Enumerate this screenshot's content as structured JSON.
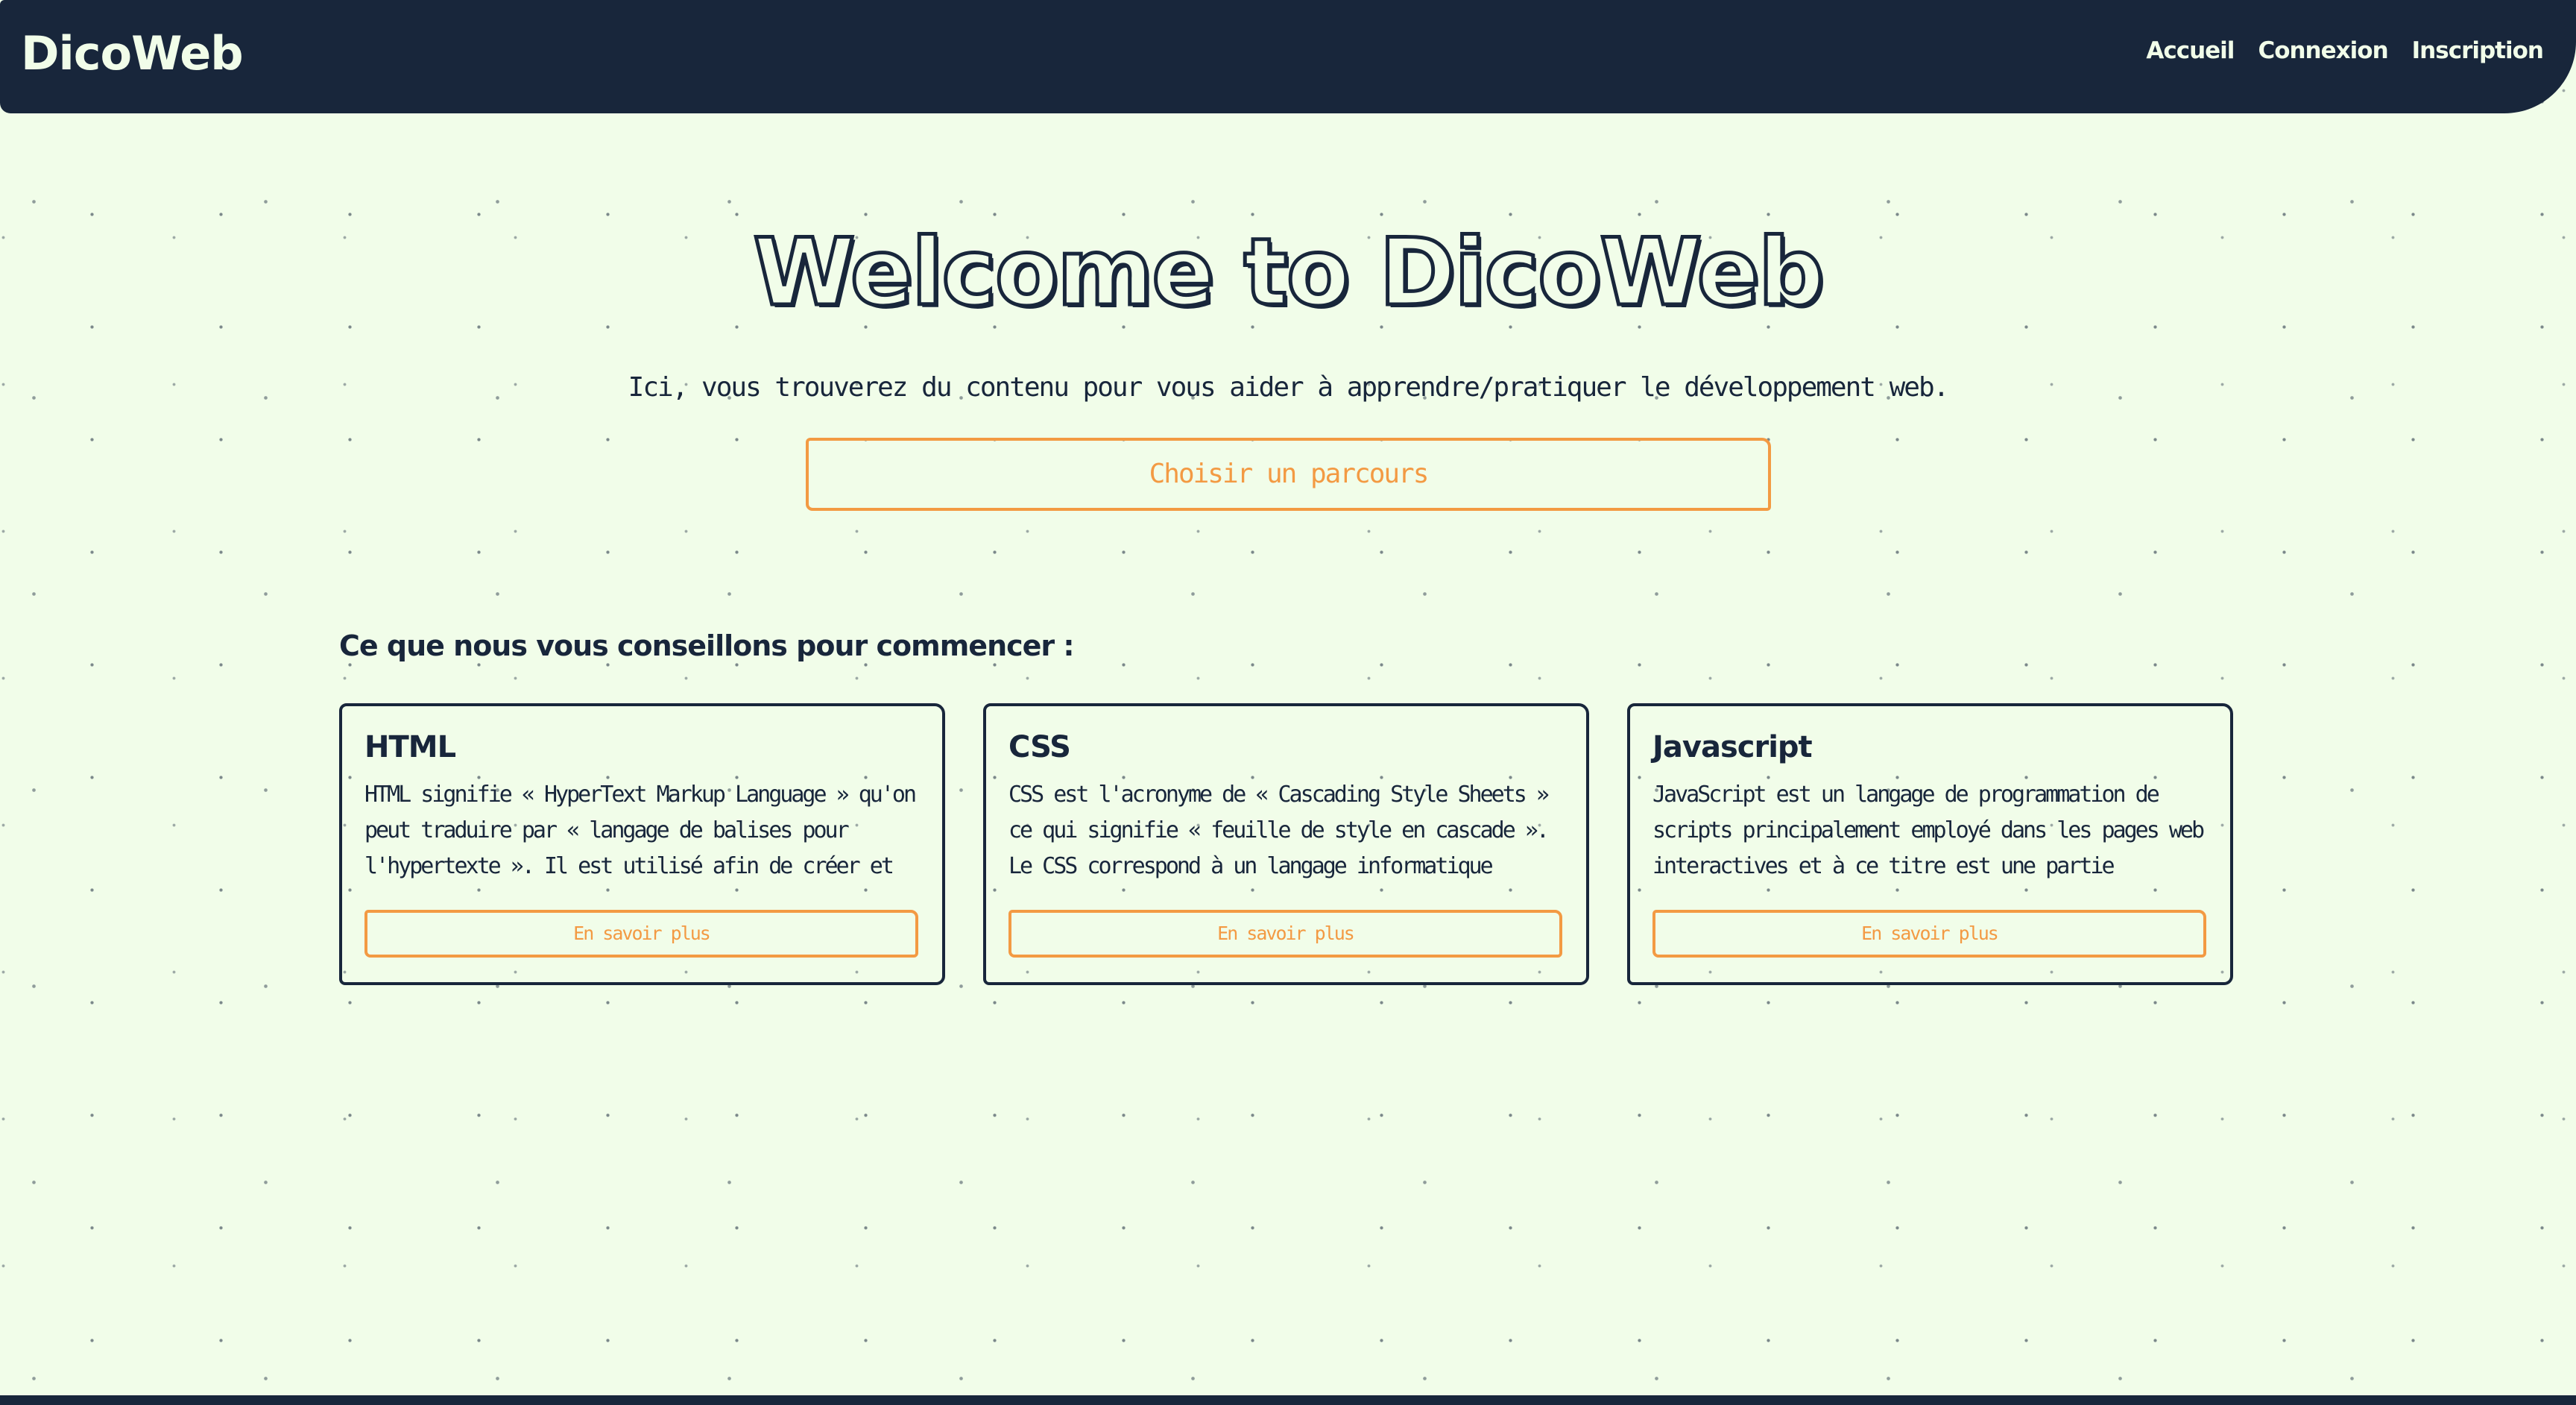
{
  "navbar": {
    "brand": "DicoWeb",
    "links": [
      "Accueil",
      "Connexion",
      "Inscription"
    ]
  },
  "hero": {
    "title": "Welcome to DicoWeb",
    "subtitle": "Ici, vous trouverez du contenu pour vous aider à apprendre/pratiquer le développement web.",
    "cta_label": "Choisir un parcours"
  },
  "recommendations": {
    "heading": "Ce que nous vous conseillons pour commencer :",
    "cards": [
      {
        "title": "HTML",
        "text": "HTML signifie « HyperText Markup Language » qu'on peut traduire par « langage de balises pour l'hypertexte ». Il est utilisé afin de créer et de...",
        "button": "En savoir plus"
      },
      {
        "title": "CSS",
        "text": "CSS est l'acronyme de « Cascading Style Sheets » ce qui signifie « feuille de style en cascade ». Le CSS correspond à un langage informatique permettant de...",
        "button": "En savoir plus"
      },
      {
        "title": "Javascript",
        "text": "JavaScript est un langage de programmation de scripts principalement employé dans les pages web interactives et à ce titre est une partie essentielle...",
        "button": "En savoir plus"
      }
    ]
  },
  "colors": {
    "background": "#f1fde9",
    "navy": "#18263b",
    "accent": "#f39a43"
  }
}
